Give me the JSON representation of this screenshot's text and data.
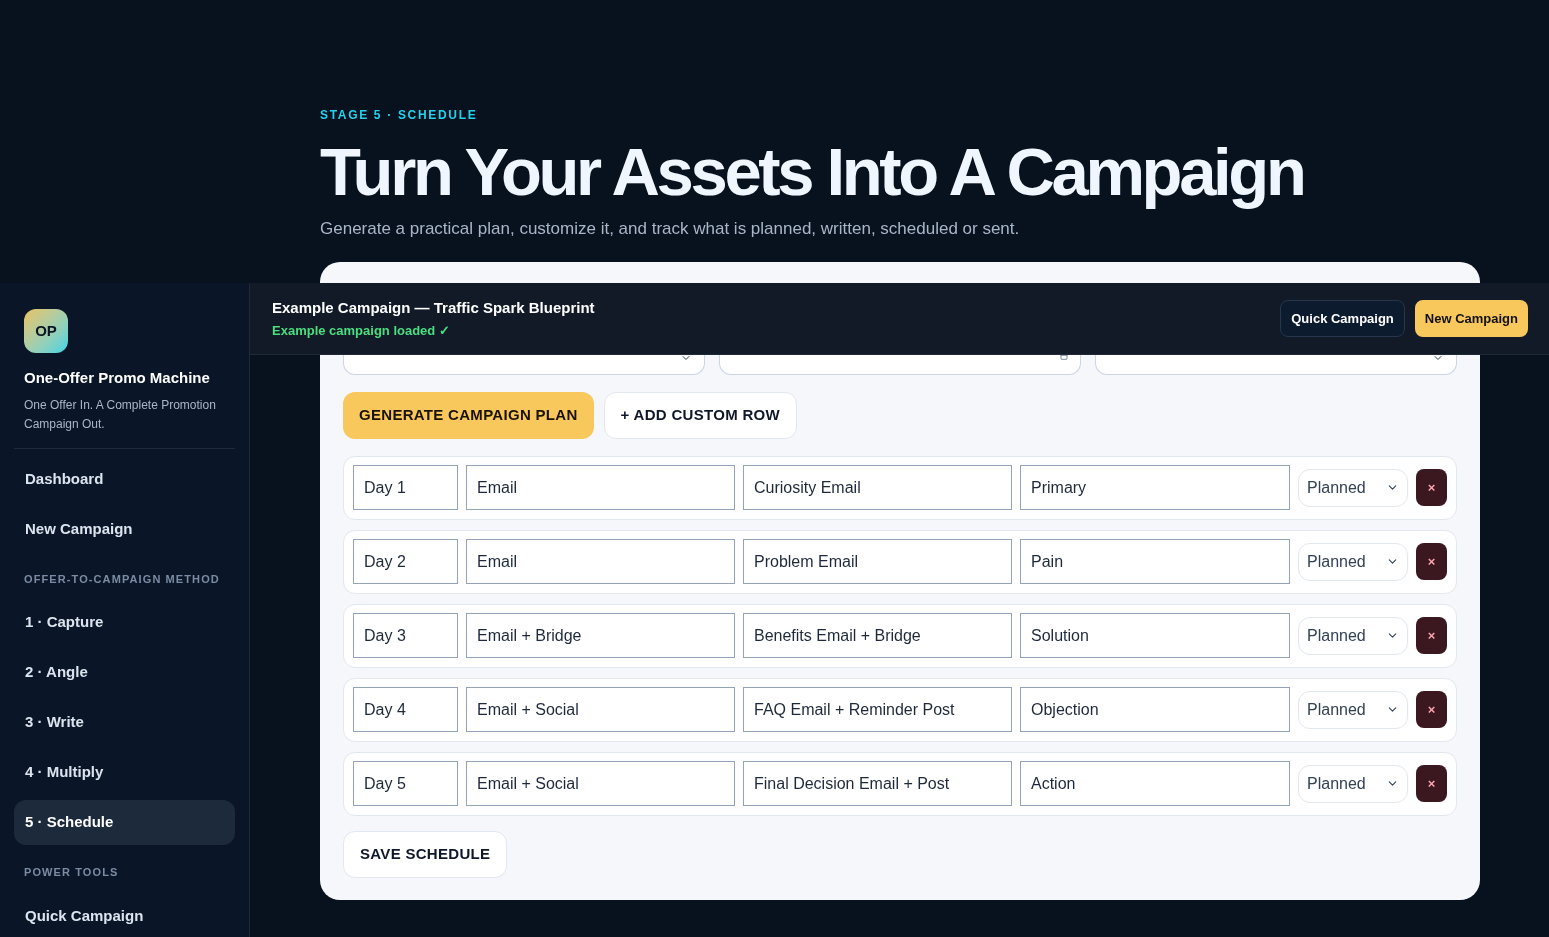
{
  "header": {
    "eyebrow": "STAGE 5 · SCHEDULE",
    "title": "Turn Your Assets Into A Campaign",
    "subtitle": "Generate a practical plan, customize it, and track what is planned, written, scheduled or sent."
  },
  "settings": [
    {
      "kind": "select"
    },
    {
      "kind": "date"
    },
    {
      "kind": "select"
    }
  ],
  "actions": [
    {
      "kind": "primary",
      "label": "GENERATE CAMPAIGN PLAN"
    },
    {
      "kind": "secondary",
      "label": "+ ADD CUSTOM ROW"
    }
  ],
  "rows": [
    {
      "day": "Day 1",
      "channel": "Email",
      "title": "Curiosity Email",
      "angle": "Primary",
      "status": "Planned",
      "remove": "×"
    },
    {
      "day": "Day 2",
      "channel": "Email",
      "title": "Problem Email",
      "angle": "Pain",
      "status": "Planned",
      "remove": "×"
    },
    {
      "day": "Day 3",
      "channel": "Email + Bridge",
      "title": "Benefits Email + Bridge",
      "angle": "Solution",
      "status": "Planned",
      "remove": "×"
    },
    {
      "day": "Day 4",
      "channel": "Email + Social",
      "title": "FAQ Email + Reminder Post",
      "angle": "Objection",
      "status": "Planned",
      "remove": "×"
    },
    {
      "day": "Day 5",
      "channel": "Email + Social",
      "title": "Final Decision Email + Post",
      "angle": "Action",
      "status": "Planned",
      "remove": "×"
    }
  ],
  "save_button": "SAVE SCHEDULE",
  "sidebar": {
    "logo": "OP",
    "app_name": "One-Offer Promo Machine",
    "tagline": "One Offer In. A Complete Promotion Campaign Out.",
    "items": [
      {
        "kind": "item",
        "label": "Dashboard",
        "selected": false
      },
      {
        "kind": "item",
        "label": "New Campaign",
        "selected": false
      },
      {
        "kind": "section",
        "label": "OFFER-TO-CAMPAIGN METHOD"
      },
      {
        "kind": "item",
        "label": "1 · Capture",
        "selected": false
      },
      {
        "kind": "item",
        "label": "2 · Angle",
        "selected": false
      },
      {
        "kind": "item",
        "label": "3 · Write",
        "selected": false
      },
      {
        "kind": "item",
        "label": "4 · Multiply",
        "selected": false
      },
      {
        "kind": "item",
        "label": "5 · Schedule",
        "selected": true
      },
      {
        "kind": "section",
        "label": "POWER TOOLS"
      },
      {
        "kind": "item",
        "label": "Quick Campaign",
        "selected": false
      }
    ]
  },
  "topbar": {
    "title": "Example Campaign — Traffic Spark Blueprint",
    "status": "Example campaign loaded ✓",
    "buttons": [
      {
        "kind": "dark",
        "label": "Quick Campaign"
      },
      {
        "kind": "accent",
        "label": "New Campaign"
      }
    ]
  }
}
